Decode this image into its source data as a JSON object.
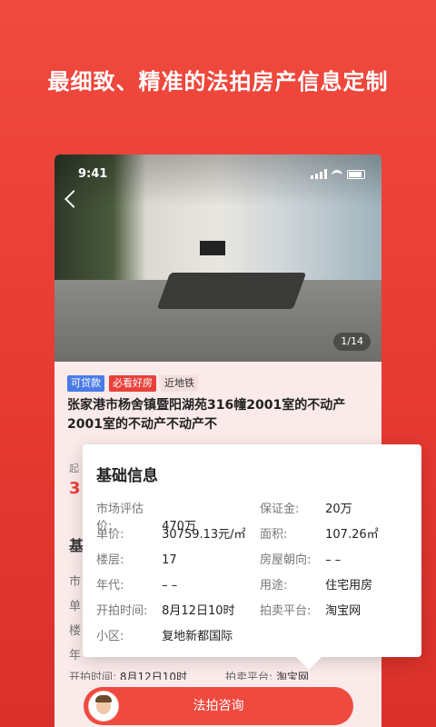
{
  "headline": "最细致、精准的法拍房产信息定制",
  "status_bar": {
    "time": "9:41"
  },
  "photo": {
    "counter": "1/14"
  },
  "tags": [
    "可贷款",
    "必看好房",
    "近地铁"
  ],
  "listing": {
    "title": "张家港市杨舍镇暨阳湖苑316幢2001室的不动产2001室的不动产不动产不"
  },
  "background_fragments": {
    "start_label": "起",
    "price_partial": "3",
    "section_partial": "基",
    "rows": [
      "市",
      "单",
      "楼",
      "年"
    ]
  },
  "bottom_row": {
    "start_label": "开拍时间:",
    "start_value": "8月12日10时",
    "platform_label": "拍卖平台:",
    "platform_value": "淘宝网"
  },
  "info_card": {
    "title": "基础信息",
    "left": [
      {
        "label": "市场评估价:",
        "value": "470万"
      },
      {
        "label": "单价:",
        "value": "30759.13元/㎡"
      },
      {
        "label": "楼层:",
        "value": "17"
      },
      {
        "label": "年代:",
        "value": "– –"
      },
      {
        "label": "开拍时间:",
        "value": "8月12日10时"
      },
      {
        "label": "小区:",
        "value": "复地新都国际"
      }
    ],
    "right": [
      {
        "label": "保证金:",
        "value": "20万"
      },
      {
        "label": "面积:",
        "value": "107.26㎡"
      },
      {
        "label": "房屋朝向:",
        "value": "– –"
      },
      {
        "label": "用途:",
        "value": "住宅用房"
      },
      {
        "label": "拍卖平台:",
        "value": "淘宝网"
      }
    ]
  },
  "consult_button": "法拍咨询",
  "colors": {
    "accent": "#ef4a40",
    "tag_blue": "#4a7be6"
  }
}
